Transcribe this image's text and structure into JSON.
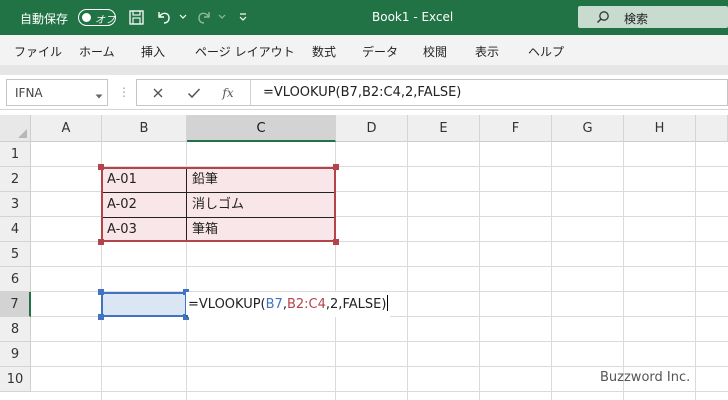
{
  "titlebar": {
    "autosave_label": "自動保存",
    "autosave_state": "オフ",
    "document_title": "Book1  -  Excel",
    "search_label": "検索"
  },
  "ribbon": {
    "tabs": [
      {
        "label": "ファイル"
      },
      {
        "label": "ホーム"
      },
      {
        "label": "挿入"
      },
      {
        "label": "ページ レイアウト"
      },
      {
        "label": "数式"
      },
      {
        "label": "データ"
      },
      {
        "label": "校閲"
      },
      {
        "label": "表示"
      },
      {
        "label": "ヘルプ"
      }
    ]
  },
  "formula_bar": {
    "name_box": "IFNA",
    "formula": "=VLOOKUP(B7,B2:C4,2,FALSE)",
    "fx_label": "fx"
  },
  "sheet": {
    "columns": [
      "A",
      "B",
      "C",
      "D",
      "E",
      "F",
      "G",
      "H"
    ],
    "active_column": "C",
    "rows": [
      "1",
      "2",
      "3",
      "4",
      "5",
      "6",
      "7",
      "8",
      "9",
      "10"
    ],
    "active_row": "7",
    "cells": {
      "B2": "A-01",
      "C2": "鉛筆",
      "B3": "A-02",
      "C3": "消しゴム",
      "B4": "A-03",
      "C4": "筆箱"
    },
    "editing": {
      "prefix": "=VLOOKUP(",
      "ref1": "B7",
      "sep1": ",",
      "ref2": "B2:C4",
      "rest": ",2,FALSE)"
    },
    "ref_colors": {
      "ref1": "#4272c4",
      "ref2": "#b5434c"
    }
  },
  "watermark": "Buzzword Inc.",
  "accent_color": "#217346"
}
